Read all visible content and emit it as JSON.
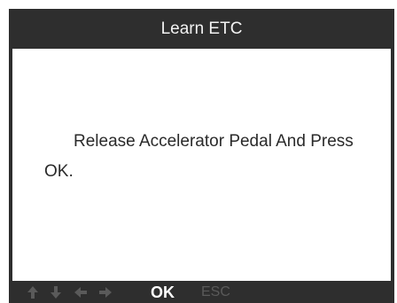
{
  "screen": {
    "title": "Learn ETC",
    "message": "Release Accelerator Pedal And Press OK."
  },
  "footer": {
    "ok_label": "OK",
    "esc_label": "ESC",
    "nav_icons": [
      "arrow-up-icon",
      "arrow-down-icon",
      "arrow-left-icon",
      "arrow-right-icon"
    ]
  },
  "colors": {
    "frame": "#2e2e2e",
    "content_bg": "#ffffff",
    "title_text": "#f2f2f2",
    "message_text": "#2a2a2a",
    "inactive_key": "#5a5a5a"
  }
}
